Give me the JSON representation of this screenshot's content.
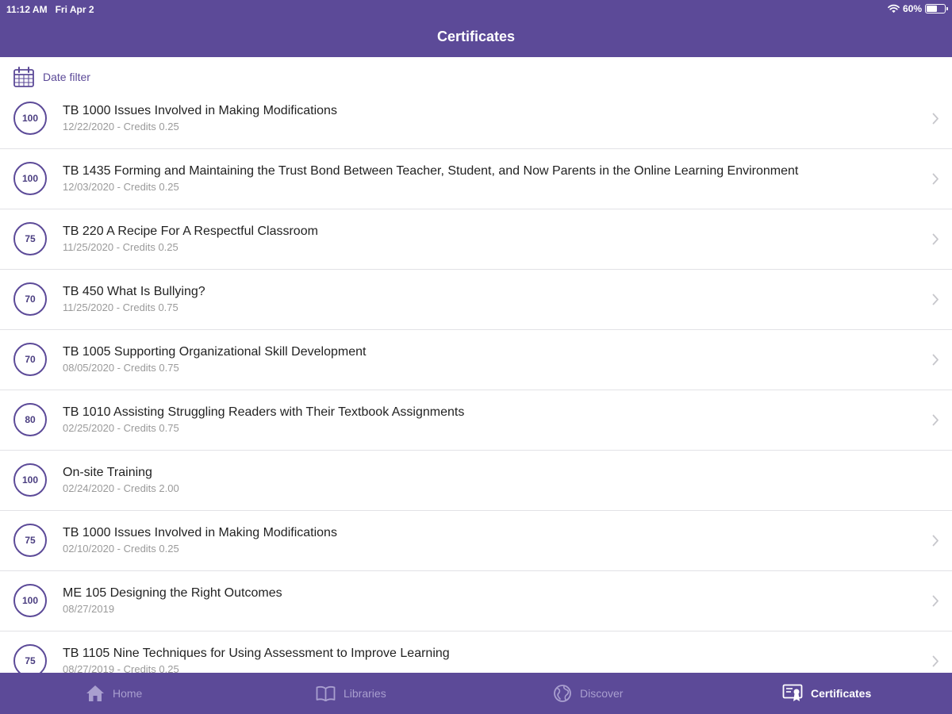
{
  "status_bar": {
    "time": "11:12 AM",
    "date": "Fri Apr 2",
    "battery": "60%",
    "battery_level": 0.6,
    "icons": [
      "wifi-icon",
      "battery-icon"
    ]
  },
  "header": {
    "title": "Certificates"
  },
  "filter": {
    "label": "Date filter",
    "icon": "calendar-icon"
  },
  "certificates": [
    {
      "score": "100",
      "title": "TB 1000 Issues Involved in Making Modifications",
      "subtitle": "12/22/2020 - Credits 0.25",
      "has_chevron": true
    },
    {
      "score": "100",
      "title": "TB 1435 Forming and Maintaining the Trust Bond Between Teacher, Student, and Now Parents in the Online Learning Environment",
      "subtitle": "12/03/2020 - Credits 0.25",
      "has_chevron": true
    },
    {
      "score": "75",
      "title": "TB 220 A Recipe For A Respectful Classroom",
      "subtitle": "11/25/2020 - Credits 0.25",
      "has_chevron": true
    },
    {
      "score": "70",
      "title": "TB 450 What Is Bullying?",
      "subtitle": "11/25/2020 - Credits 0.75",
      "has_chevron": true
    },
    {
      "score": "70",
      "title": "TB 1005 Supporting Organizational Skill Development",
      "subtitle": "08/05/2020 - Credits 0.75",
      "has_chevron": true
    },
    {
      "score": "80",
      "title": "TB 1010 Assisting Struggling Readers with Their Textbook Assignments",
      "subtitle": "02/25/2020 - Credits 0.75",
      "has_chevron": true
    },
    {
      "score": "100",
      "title": "On-site Training",
      "subtitle": "02/24/2020 - Credits 2.00",
      "has_chevron": false
    },
    {
      "score": "75",
      "title": "TB 1000 Issues Involved in Making Modifications",
      "subtitle": "02/10/2020 - Credits 0.25",
      "has_chevron": true
    },
    {
      "score": "100",
      "title": "ME 105 Designing the Right Outcomes",
      "subtitle": "08/27/2019",
      "has_chevron": true
    },
    {
      "score": "75",
      "title": "TB 1105 Nine Techniques for Using Assessment to Improve Learning",
      "subtitle": "08/27/2019 - Credits 0.25",
      "has_chevron": true
    }
  ],
  "tabbar": {
    "tabs": [
      {
        "label": "Home",
        "icon": "home-icon",
        "active": false
      },
      {
        "label": "Libraries",
        "icon": "book-icon",
        "active": false
      },
      {
        "label": "Discover",
        "icon": "globe-icon",
        "active": false
      },
      {
        "label": "Certificates",
        "icon": "certificate-icon",
        "active": true
      }
    ]
  },
  "colors": {
    "brand": "#5c4a98",
    "tab_inactive": "#a99fcf",
    "subtitle": "#9a9a9a",
    "chevron": "#c7c7cc",
    "divider": "#e2e2e6"
  }
}
